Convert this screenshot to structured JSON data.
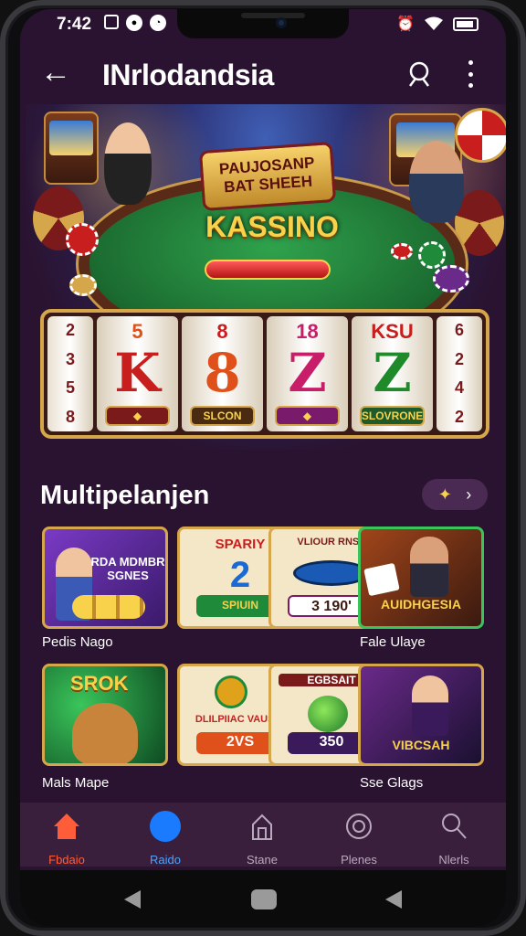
{
  "status_bar": {
    "time": "7:42",
    "left_icons": [
      "grid-icon",
      "signal-app-icon",
      "chat-icon"
    ],
    "right_icons": [
      "alarm-icon",
      "wifi-icon",
      "battery-icon"
    ]
  },
  "app_bar": {
    "back_icon": "arrow-left-icon",
    "title": "INrlodandsia",
    "search_icon": "search-icon",
    "more_icon": "more-vertical-icon"
  },
  "hero": {
    "banner_text": "PAUJOSANP BAT SHEEH",
    "headline": "KASSINO"
  },
  "reels": {
    "left_edge": [
      "2",
      "3",
      "5",
      "8"
    ],
    "right_edge": [
      "6",
      "2",
      "4",
      "2"
    ],
    "items": [
      {
        "top": "5",
        "symbol": "K",
        "label": "",
        "color": "#c81e1e"
      },
      {
        "top": "8",
        "symbol": "8",
        "label": "SLCON",
        "color": "#e0501a"
      },
      {
        "top": "18",
        "symbol": "Z",
        "label": "",
        "color": "#c81e6a"
      },
      {
        "top": "KSU",
        "symbol": "Z",
        "label": "SLOVRONE",
        "color": "#1e8a2a"
      }
    ]
  },
  "section": {
    "title": "Multipelanjen",
    "pill_icon": "star-burst-icon",
    "pill_chevron": "chevron-right-icon"
  },
  "games_row1": [
    {
      "title": "RDA MDMBR SGNES",
      "button": "",
      "label": "Pedis Nago",
      "bg": "#6a3ab5"
    },
    {
      "title": "SPARIY",
      "button": "SPIUIN",
      "label": "",
      "bg": "#f4e7c8"
    },
    {
      "title": "VLIOUR RNSS",
      "button": "3 190'",
      "label": "",
      "bg": "#f4e7c8"
    },
    {
      "title": "AUIDHGESIA",
      "button": "",
      "label": "Fale Ulaye",
      "bg": "#7a2a18"
    }
  ],
  "games_row2": [
    {
      "title": "SROK",
      "button": "",
      "label": "Mals Mape",
      "bg": "#1e7a3a"
    },
    {
      "title": "DLILPIIAC VAUSIO",
      "button": "2VS",
      "label": "",
      "bg": "#f4e7c8"
    },
    {
      "title": "EGBSAIT",
      "button": "350",
      "label": "",
      "bg": "#f4e7c8"
    },
    {
      "title": "VIBCSAH",
      "button": "",
      "label": "Sse Glags",
      "bg": "#4a2a6a"
    }
  ],
  "nav": [
    {
      "label": "Fbdaio",
      "icon": "home-icon"
    },
    {
      "label": "Raido",
      "icon": "circle-icon"
    },
    {
      "label": "Stane",
      "icon": "store-icon"
    },
    {
      "label": "Plenes",
      "icon": "target-icon"
    },
    {
      "label": "Nlerls",
      "icon": "search-icon"
    }
  ],
  "colors": {
    "background": "#2a1330",
    "accent": "#d6a64a",
    "nav_active": "#ff5d3a",
    "nav_blue": "#1a7bff"
  }
}
